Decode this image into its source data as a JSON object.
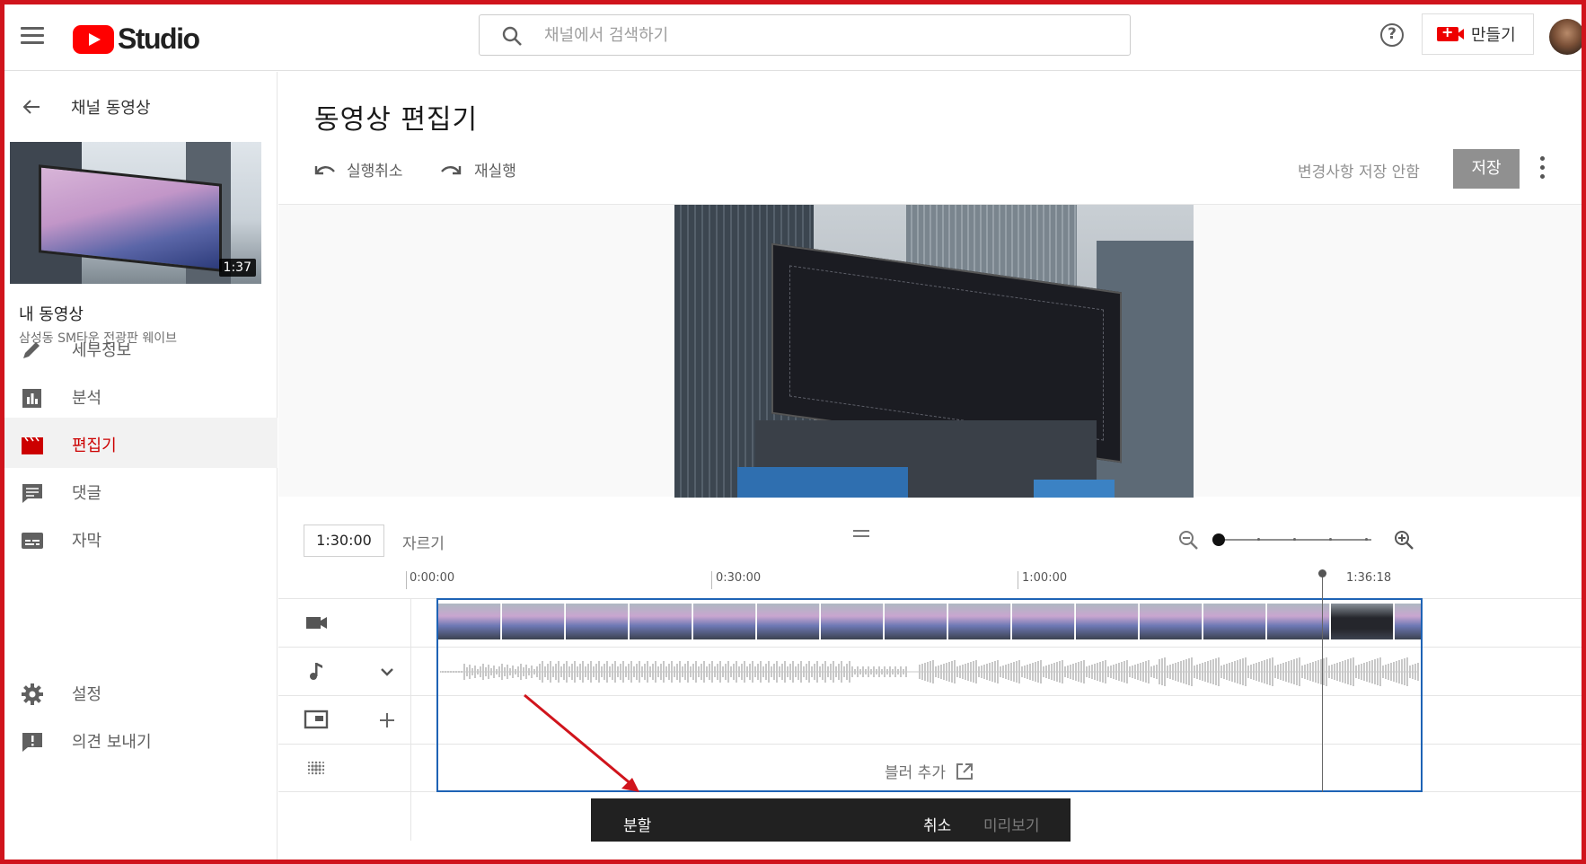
{
  "app": {
    "name": "Studio"
  },
  "search": {
    "placeholder": "채널에서 검색하기"
  },
  "header": {
    "create_label": "만들기"
  },
  "sidebar": {
    "back_label": "채널 동영상",
    "video": {
      "duration": "1:37",
      "title": "내 동영상",
      "subtitle": "삼성동 SM타운 전광판 웨이브"
    },
    "items": [
      {
        "label": "세부정보",
        "icon": "pencil-icon"
      },
      {
        "label": "분석",
        "icon": "analytics-icon"
      },
      {
        "label": "편집기",
        "icon": "clapperboard-icon",
        "active": true
      },
      {
        "label": "댓글",
        "icon": "comment-icon"
      },
      {
        "label": "자막",
        "icon": "subtitles-icon"
      }
    ],
    "bottom_items": [
      {
        "label": "설정",
        "icon": "gear-icon"
      },
      {
        "label": "의견 보내기",
        "icon": "feedback-icon"
      }
    ]
  },
  "editor": {
    "title": "동영상 편집기",
    "undo_label": "실행취소",
    "redo_label": "재실행",
    "unsaved_label": "변경사항 저장 안함",
    "save_label": "저장"
  },
  "timeline": {
    "timecode": "1:30:00",
    "trim_label": "자르기",
    "ruler": [
      "0:00:00",
      "0:30:00",
      "1:00:00",
      "1:36:18"
    ],
    "blur_label": "블러 추가",
    "playhead_fraction": 0.935
  },
  "bottom_bar": {
    "split_label": "분할",
    "cancel_label": "취소",
    "preview_label": "미리보기"
  },
  "colors": {
    "accent": "#cc0000",
    "selection": "#1e63b5",
    "save_disabled": "#909090",
    "frame": "#d0141c"
  }
}
